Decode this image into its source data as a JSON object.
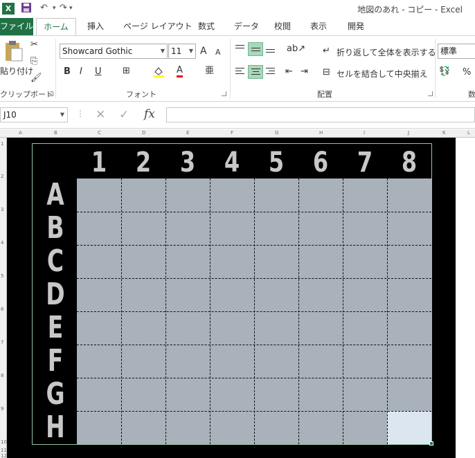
{
  "titlebar": {
    "app_icon": "X",
    "save_icon": "floppy-icon",
    "undo_icon": "undo-icon",
    "title": "地図のあれ - コピー - Excel"
  },
  "tabs": [
    {
      "label": "ファイル"
    },
    {
      "label": "ホーム"
    },
    {
      "label": "挿入"
    },
    {
      "label": "ページ レイアウト"
    },
    {
      "label": "数式"
    },
    {
      "label": "データ"
    },
    {
      "label": "校閲"
    },
    {
      "label": "表示"
    },
    {
      "label": "開発"
    }
  ],
  "ribbon": {
    "clipboard": {
      "paste_label": "貼り付け",
      "group_label": "クリップボード"
    },
    "font": {
      "family": "Showcard Gothic",
      "size": "11",
      "group_label": "フォント",
      "bold": "B",
      "italic": "I",
      "underline": "U",
      "grow": "A",
      "shrink": "A",
      "font_color": "A"
    },
    "alignment": {
      "wrap_label": "折り返して全体を表示する",
      "merge_label": "セルを結合して中央揃え",
      "group_label": "配置"
    },
    "number": {
      "format": "標準",
      "percent": "%",
      "group_label": "数"
    }
  },
  "formula_bar": {
    "name_box": "J10",
    "cancel": "✕",
    "enter": "✓",
    "fx": "fx",
    "value": ""
  },
  "sheet": {
    "col_headers": [
      "A",
      "B",
      "C",
      "D",
      "E",
      "F",
      "G",
      "H",
      "I",
      "J",
      "K",
      "L"
    ],
    "row_headers": [
      "1",
      "2",
      "3",
      "4",
      "5",
      "6",
      "7",
      "8",
      "9",
      "10",
      "11",
      "12"
    ],
    "board": {
      "columns": [
        "1",
        "2",
        "3",
        "4",
        "5",
        "6",
        "7",
        "8"
      ],
      "rows": [
        "A",
        "B",
        "C",
        "D",
        "E",
        "F",
        "G",
        "H"
      ],
      "cell_color": "#a9b1ba",
      "selected_cell_color": "#dbe6f1",
      "background": "#000000"
    }
  }
}
